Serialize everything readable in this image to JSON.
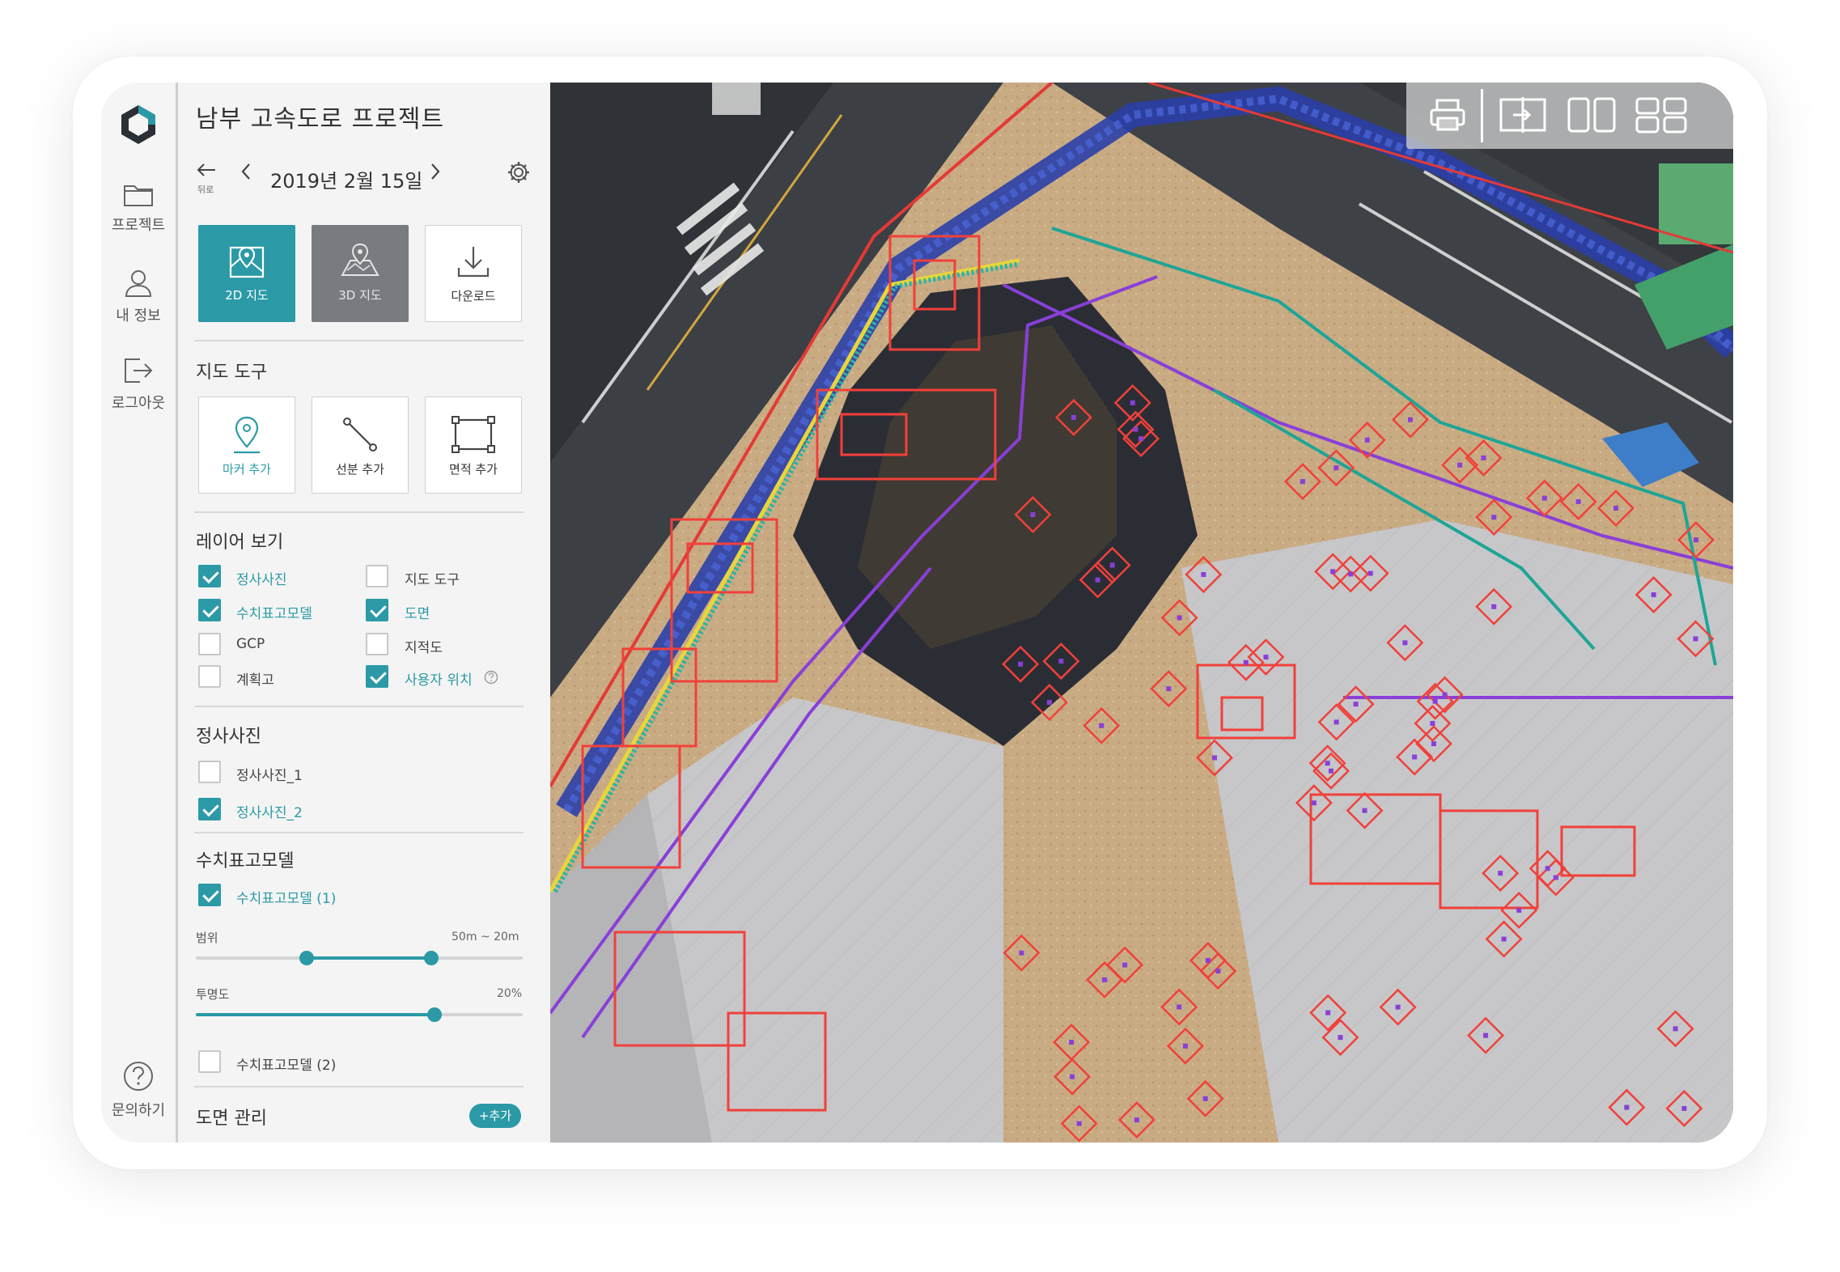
{
  "app": {
    "accent": "#2b9aa6"
  },
  "rail": {
    "items": [
      {
        "label": "프로젝트",
        "icon": "folder-icon"
      },
      {
        "label": "내 정보",
        "icon": "user-icon"
      },
      {
        "label": "로그아웃",
        "icon": "logout-icon"
      }
    ],
    "help_label": "문의하기"
  },
  "panel": {
    "project_title": "남부 고속도로 프로젝트",
    "back_label": "뒤로",
    "date": "2019년 2월 15일",
    "view_modes": [
      {
        "label": "2D 지도",
        "icon": "map-2d-icon",
        "active": true
      },
      {
        "label": "3D 지도",
        "icon": "map-3d-icon",
        "active": false
      },
      {
        "label": "다운로드",
        "icon": "download-icon",
        "active": false
      }
    ],
    "map_tools_title": "지도 도구",
    "map_tools": [
      {
        "label": "마커 추가",
        "icon": "marker-icon"
      },
      {
        "label": "선분 추가",
        "icon": "line-icon"
      },
      {
        "label": "면적 추가",
        "icon": "area-icon"
      }
    ],
    "layers_title": "레이어 보기",
    "layers": [
      {
        "label": "정사사진",
        "checked": true
      },
      {
        "label": "지도 도구",
        "checked": false
      },
      {
        "label": "수치표고모델",
        "checked": true
      },
      {
        "label": "도면",
        "checked": true
      },
      {
        "label": "GCP",
        "checked": false
      },
      {
        "label": "지적도",
        "checked": false
      },
      {
        "label": "계획고",
        "checked": false
      },
      {
        "label": "사용자 위치",
        "checked": true
      }
    ],
    "ortho_title": "정사사진",
    "ortho_items": [
      {
        "label": "정사사진_1",
        "checked": false
      },
      {
        "label": "정사사진_2",
        "checked": true
      }
    ],
    "dem_title": "수치표고모델",
    "dem_items": [
      {
        "label": "수치표고모델 (1)",
        "checked": true
      },
      {
        "label": "수치표고모델 (2)",
        "checked": false
      }
    ],
    "range_label": "범위",
    "range_value_low": "50m",
    "range_sep": "~",
    "range_value_high": "20m",
    "range_fraction": [
      0.34,
      0.72
    ],
    "opacity_label": "투명도",
    "opacity_value": "20%",
    "opacity_fraction": 0.73,
    "drawings_title": "도면 관리",
    "add_button_label": "+추가"
  },
  "map_toolbar": {
    "buttons": [
      "print-icon",
      "compare-icon",
      "split-view-icon",
      "quad-view-icon"
    ]
  }
}
